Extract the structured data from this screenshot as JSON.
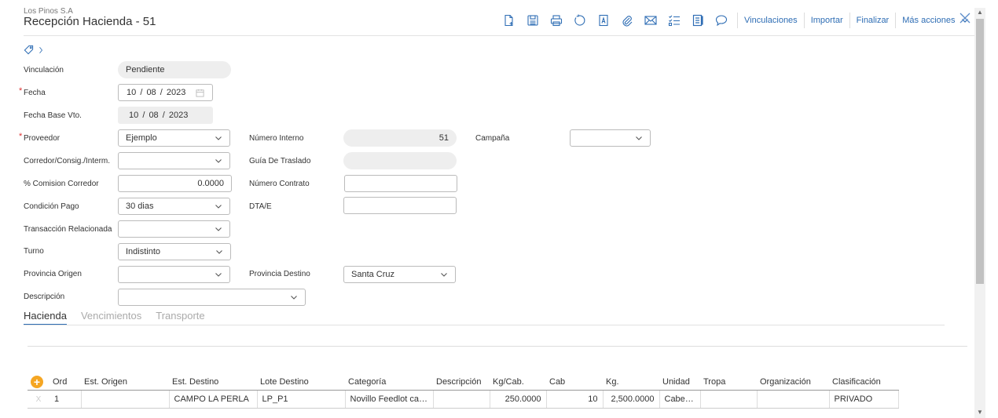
{
  "header": {
    "company": "Los Pinos S.A",
    "title": "Recepción Hacienda - 51",
    "links": {
      "vinculaciones": "Vinculaciones",
      "importar": "Importar",
      "finalizar": "Finalizar",
      "mas_acciones": "Más acciones"
    },
    "accent_color": "#2e6db4"
  },
  "form": {
    "vinculacion": {
      "label": "Vinculación",
      "value": "Pendiente"
    },
    "fecha": {
      "label": "Fecha",
      "day": "10",
      "month": "08",
      "year": "2023",
      "sep": "/"
    },
    "fecha_base": {
      "label": "Fecha Base Vto.",
      "day": "10",
      "month": "08",
      "year": "2023"
    },
    "proveedor": {
      "label": "Proveedor",
      "value": "Ejemplo"
    },
    "numero_interno": {
      "label": "Número Interno",
      "value": "51"
    },
    "campana": {
      "label": "Campaña",
      "value": ""
    },
    "corredor": {
      "label": "Corredor/Consig./Interm.",
      "value": ""
    },
    "guia": {
      "label": "Guía De Traslado",
      "value": ""
    },
    "comision": {
      "label": "% Comision Corredor",
      "value": "0.0000"
    },
    "numero_contrato": {
      "label": "Número Contrato",
      "value": ""
    },
    "condicion_pago": {
      "label": "Condición Pago",
      "value": "30 dias"
    },
    "dtae": {
      "label": "DTA/E",
      "value": ""
    },
    "transaccion": {
      "label": "Transacción Relacionada",
      "value": ""
    },
    "turno": {
      "label": "Turno",
      "value": "Indistinto"
    },
    "provincia_origen": {
      "label": "Provincia Origen",
      "value": ""
    },
    "provincia_destino": {
      "label": "Provincia Destino",
      "value": "Santa Cruz"
    },
    "descripcion": {
      "label": "Descripción",
      "value": ""
    }
  },
  "tabs": [
    {
      "label": "Hacienda",
      "active": true
    },
    {
      "label": "Vencimientos",
      "active": false
    },
    {
      "label": "Transporte",
      "active": false
    }
  ],
  "grid": {
    "add_symbol": "+",
    "delete_symbol": "X",
    "columns": [
      "Ord",
      "Est. Origen",
      "Est. Destino",
      "Lote Destino",
      "Categoría",
      "Descripción",
      "Kg/Cab.",
      "Cab",
      "Kg.",
      "Unidad",
      "Tropa",
      "Organización",
      "Clasificación"
    ],
    "rows": [
      [
        "1",
        "",
        "CAMPO LA PERLA",
        "LP_P1",
        "Novillo Feedlot car…",
        "",
        "250.0000",
        "10",
        "2,500.0000",
        "Cabe…",
        "",
        "",
        "PRIVADO"
      ]
    ]
  }
}
